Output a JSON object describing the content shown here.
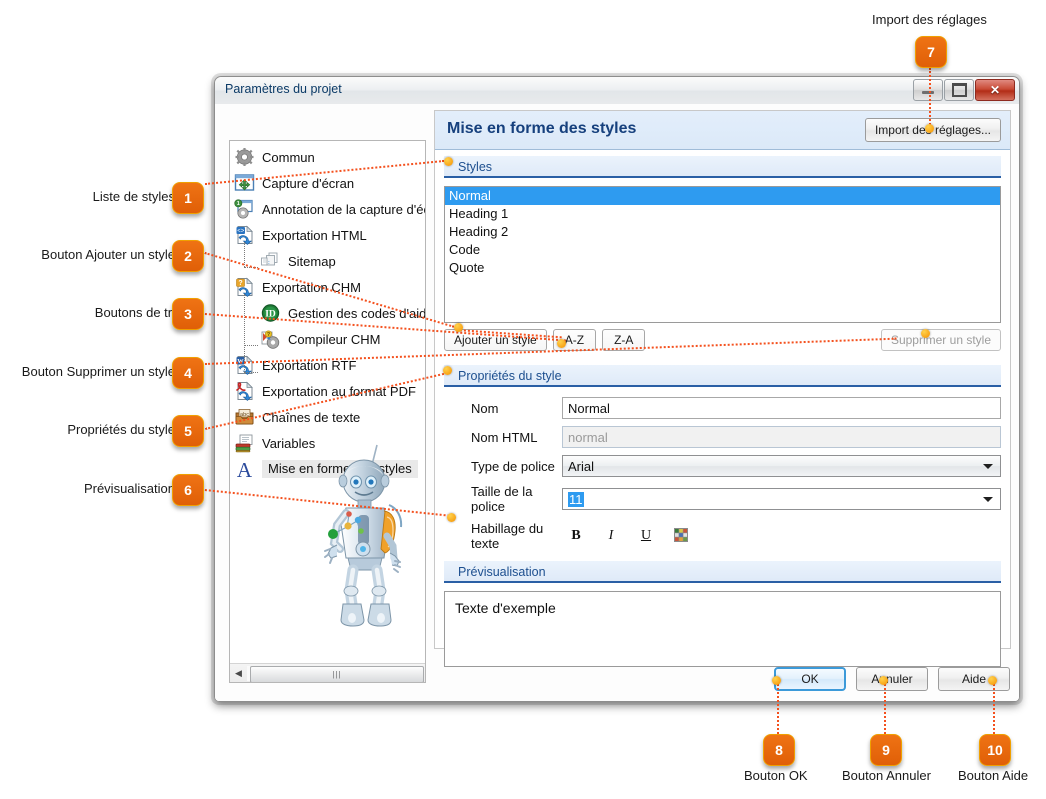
{
  "window": {
    "title": "Paramètres du projet",
    "controls": {
      "minimize": "minimize-icon",
      "maximize": "maximize-icon",
      "close": "✕"
    }
  },
  "tree": {
    "items": [
      {
        "label": "Commun",
        "icon": "gear-icon",
        "level": 0,
        "selected": false
      },
      {
        "label": "Capture d'écran",
        "icon": "screen-capture-icon",
        "level": 0,
        "selected": false
      },
      {
        "label": "Annotation de la capture d'écr",
        "icon": "annotation-icon",
        "level": 0,
        "selected": false
      },
      {
        "label": "Exportation HTML",
        "icon": "html-export-icon",
        "level": 0,
        "selected": false
      },
      {
        "label": "Sitemap",
        "icon": "sitemap-icon",
        "level": 1,
        "selected": false
      },
      {
        "label": "Exportation CHM",
        "icon": "chm-export-icon",
        "level": 0,
        "selected": false
      },
      {
        "label": "Gestion des codes d'aide",
        "icon": "id-badge-icon",
        "level": 1,
        "selected": false
      },
      {
        "label": "Compileur CHM",
        "icon": "compiler-icon",
        "level": 1,
        "selected": false
      },
      {
        "label": "Exportation RTF",
        "icon": "rtf-export-icon",
        "level": 0,
        "selected": false
      },
      {
        "label": "Exportation au format PDF",
        "icon": "pdf-export-icon",
        "level": 0,
        "selected": false
      },
      {
        "label": "Chaînes de texte",
        "icon": "text-strings-icon",
        "level": 0,
        "selected": false
      },
      {
        "label": "Variables",
        "icon": "variables-icon",
        "level": 0,
        "selected": false
      },
      {
        "label": "Mise en forme des styles",
        "icon": "letter-a-icon",
        "level": 0,
        "selected": true
      }
    ]
  },
  "pane": {
    "title": "Mise en forme des styles",
    "import_button": "Import des réglages...",
    "styles_group": {
      "title": "Styles",
      "items": [
        "Normal",
        "Heading 1",
        "Heading 2",
        "Code",
        "Quote"
      ],
      "selected_index": 0,
      "buttons": {
        "add": "Ajouter un style",
        "sort_az": "A-Z",
        "sort_za": "Z-A",
        "delete": "Supprimer un style"
      }
    },
    "properties_group": {
      "title": "Propriétés du style",
      "fields": [
        {
          "label": "Nom",
          "value": "Normal",
          "type": "text"
        },
        {
          "label": "Nom HTML",
          "value": "normal",
          "type": "text-readonly"
        },
        {
          "label": "Type de police",
          "value": "Arial",
          "type": "select"
        },
        {
          "label": "Taille de la police",
          "value": "11",
          "type": "select-editable"
        }
      ],
      "text_wrap_label": "Habillage du texte",
      "format_buttons": [
        "B",
        "I",
        "U",
        "color-swatch-icon"
      ]
    },
    "preview_group": {
      "title": "Prévisualisation",
      "sample_text": "Texte d'exemple"
    }
  },
  "footer": {
    "ok": "OK",
    "cancel": "Annuler",
    "help": "Aide"
  },
  "annotations": [
    {
      "number": "1",
      "label": "Liste de styles"
    },
    {
      "number": "2",
      "label": "Bouton Ajouter un style"
    },
    {
      "number": "3",
      "label": "Boutons de tri"
    },
    {
      "number": "4",
      "label": "Bouton Supprimer un style"
    },
    {
      "number": "5",
      "label": "Propriétés du style"
    },
    {
      "number": "6",
      "label": "Prévisualisation"
    },
    {
      "number": "7",
      "label": "Import des réglages"
    },
    {
      "number": "8",
      "label": "Bouton OK"
    },
    {
      "number": "9",
      "label": "Bouton Annuler"
    },
    {
      "number": "10",
      "label": "Bouton Aide"
    }
  ],
  "colors": {
    "callout": "#e8640c",
    "leader": "#f4511e",
    "dot": "#f9a825",
    "accent": "#2e9bf0",
    "pane_title": "#16407d",
    "group_title": "#1d4f8f"
  }
}
